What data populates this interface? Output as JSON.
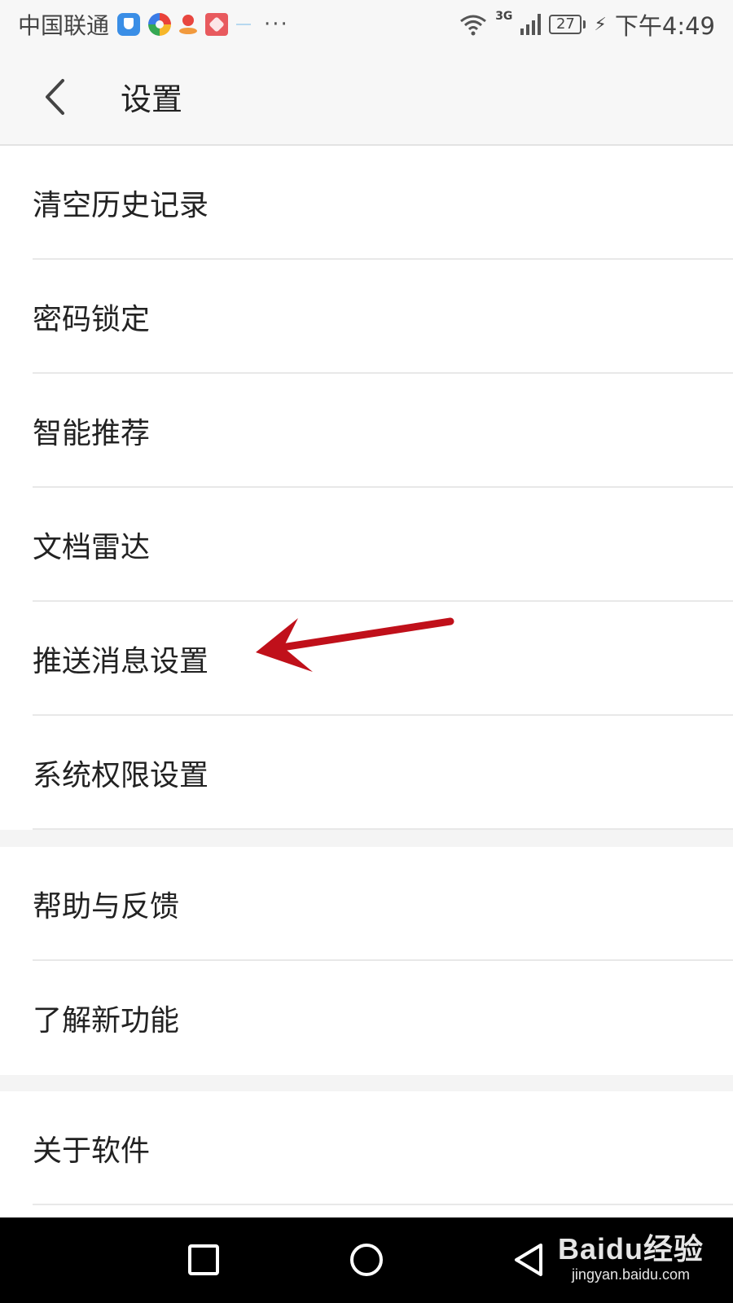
{
  "status_bar": {
    "carrier": "中国联通",
    "more": "···",
    "network": "3G",
    "battery": "27",
    "time": "下午4:49"
  },
  "header": {
    "title": "设置"
  },
  "groups": [
    {
      "items": [
        {
          "label": "清空历史记录"
        },
        {
          "label": "密码锁定"
        },
        {
          "label": "智能推荐"
        },
        {
          "label": "文档雷达"
        },
        {
          "label": "推送消息设置"
        },
        {
          "label": "系统权限设置"
        }
      ]
    },
    {
      "items": [
        {
          "label": "帮助与反馈"
        },
        {
          "label": "了解新功能"
        }
      ]
    },
    {
      "items": [
        {
          "label": "关于软件"
        }
      ]
    }
  ],
  "annotation": {
    "color": "#c0101a"
  },
  "watermark": {
    "brand": "Baidu经验",
    "url": "jingyan.baidu.com"
  }
}
